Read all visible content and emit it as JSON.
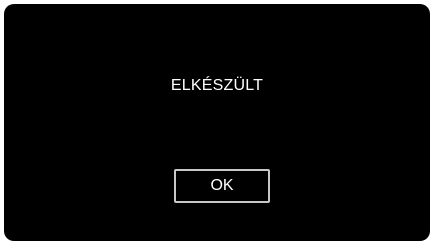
{
  "dialog": {
    "message": "ELKÉSZÜLT",
    "ok_label": "OK"
  },
  "colors": {
    "background": "#000000",
    "text": "#ffffff",
    "button_border": "#c8c8c8"
  }
}
